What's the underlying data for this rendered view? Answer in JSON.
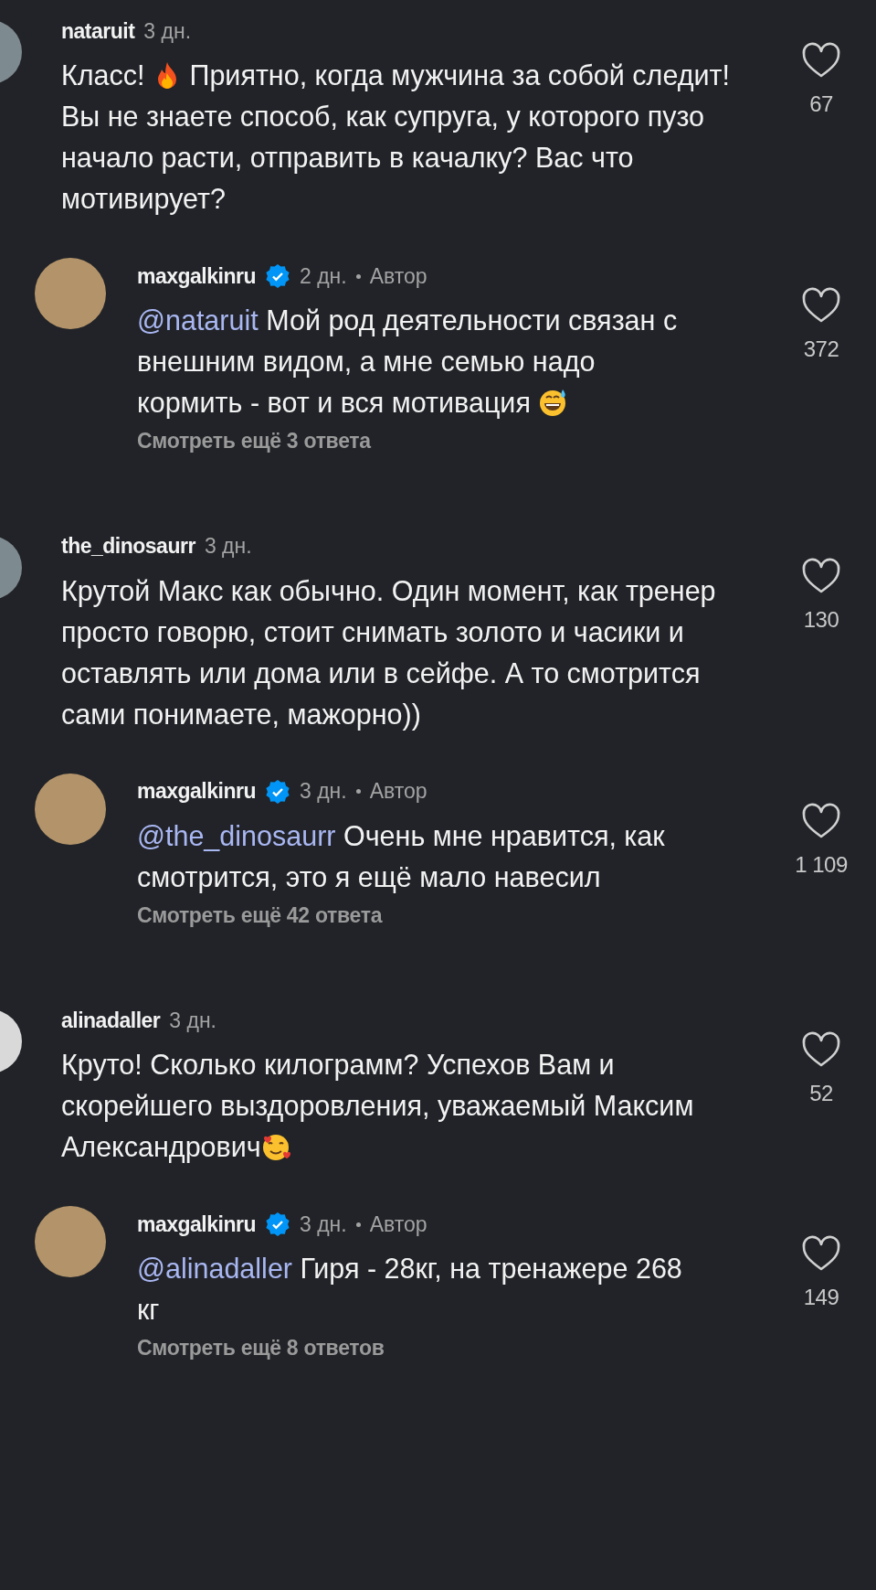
{
  "comments": [
    {
      "username": "nataruit",
      "time": "3 дн.",
      "likes": "67",
      "liked": false,
      "body": [
        {
          "kind": "text",
          "text": "Класс! "
        },
        {
          "kind": "fire"
        },
        {
          "kind": "text",
          "text": " Приятно, когда мужчина за собой следит! Вы не знаете способ, как супруга, у которого пузо начало расти, отправить в качалку? Вас что мотивирует?"
        }
      ],
      "replies": [
        {
          "username": "maxgalkinru",
          "verified": true,
          "time": "2 дн.",
          "author_label": "Автор",
          "likes": "372",
          "liked": false,
          "body": [
            {
              "kind": "mention",
              "text": "@nataruit"
            },
            {
              "kind": "text",
              "text": " Мой род деятельности связан с внешним видом, а мне семью надо кормить - вот и вся мотивация "
            },
            {
              "kind": "sweat"
            }
          ],
          "more_replies": "Смотреть ещё 3 ответа"
        }
      ]
    },
    {
      "username": "the_dinosaurr",
      "time": "3 дн.",
      "likes": "130",
      "liked": false,
      "body": [
        {
          "kind": "text",
          "text": "Крутой Макс как обычно. Один момент, как тренер просто говорю, стоит снимать золото и часики и оставлять или дома или в сейфе. А то смотрится сами понимаете, мажорно))"
        }
      ],
      "replies": [
        {
          "username": "maxgalkinru",
          "verified": true,
          "time": "3 дн.",
          "author_label": "Автор",
          "likes": "1 109",
          "liked": false,
          "body": [
            {
              "kind": "mention",
              "text": "@the_dinosaurr"
            },
            {
              "kind": "text",
              "text": " Очень мне нравится, как смотрится, это я ещё мало навесил"
            }
          ],
          "more_replies": "Смотреть ещё 42 ответа"
        }
      ]
    },
    {
      "username": "alinadaller",
      "time": "3 дн.",
      "likes": "52",
      "liked": false,
      "body": [
        {
          "kind": "text",
          "text": "Круто! Сколько килограмм? Успехов Вам и скорейшего выздоровления, уважаемый Максим Александрович"
        },
        {
          "kind": "hearts"
        }
      ],
      "replies": [
        {
          "username": "maxgalkinru",
          "verified": true,
          "time": "3 дн.",
          "author_label": "Автор",
          "likes": "149",
          "liked": false,
          "body": [
            {
              "kind": "mention",
              "text": "@alinadaller"
            },
            {
              "kind": "text",
              "text": " Гиря - 28кг, на тренажере 268 кг"
            }
          ],
          "more_replies": "Смотреть ещё 8 ответов"
        }
      ]
    }
  ]
}
